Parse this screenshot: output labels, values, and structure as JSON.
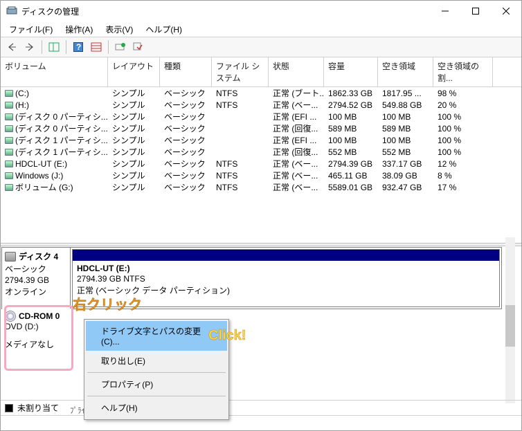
{
  "window": {
    "title": "ディスクの管理"
  },
  "menubar": [
    "ファイル(F)",
    "操作(A)",
    "表示(V)",
    "ヘルプ(H)"
  ],
  "columns": [
    "ボリューム",
    "レイアウト",
    "種類",
    "ファイル システム",
    "状態",
    "容量",
    "空き領域",
    "空き領域の割..."
  ],
  "rows": [
    {
      "vol": "(C:)",
      "layout": "シンプル",
      "type": "ベーシック",
      "fs": "NTFS",
      "status": "正常 (ブート...",
      "cap": "1862.33 GB",
      "free": "1817.95 ...",
      "pct": "98 %"
    },
    {
      "vol": "(H:)",
      "layout": "シンプル",
      "type": "ベーシック",
      "fs": "NTFS",
      "status": "正常 (ベー...",
      "cap": "2794.52 GB",
      "free": "549.88 GB",
      "pct": "20 %"
    },
    {
      "vol": "(ディスク 0 パーティシ...",
      "layout": "シンプル",
      "type": "ベーシック",
      "fs": "",
      "status": "正常 (EFI ...",
      "cap": "100 MB",
      "free": "100 MB",
      "pct": "100 %"
    },
    {
      "vol": "(ディスク 0 パーティシ...",
      "layout": "シンプル",
      "type": "ベーシック",
      "fs": "",
      "status": "正常 (回復...",
      "cap": "589 MB",
      "free": "589 MB",
      "pct": "100 %"
    },
    {
      "vol": "(ディスク 1 パーティシ...",
      "layout": "シンプル",
      "type": "ベーシック",
      "fs": "",
      "status": "正常 (EFI ...",
      "cap": "100 MB",
      "free": "100 MB",
      "pct": "100 %"
    },
    {
      "vol": "(ディスク 1 パーティシ...",
      "layout": "シンプル",
      "type": "ベーシック",
      "fs": "",
      "status": "正常 (回復...",
      "cap": "552 MB",
      "free": "552 MB",
      "pct": "100 %"
    },
    {
      "vol": "HDCL-UT (E:)",
      "layout": "シンプル",
      "type": "ベーシック",
      "fs": "NTFS",
      "status": "正常 (ベー...",
      "cap": "2794.39 GB",
      "free": "337.17 GB",
      "pct": "12 %"
    },
    {
      "vol": "Windows (J:)",
      "layout": "シンプル",
      "type": "ベーシック",
      "fs": "NTFS",
      "status": "正常 (ベー...",
      "cap": "465.11 GB",
      "free": "38.09 GB",
      "pct": "8 %"
    },
    {
      "vol": "ボリューム (G:)",
      "layout": "シンプル",
      "type": "ベーシック",
      "fs": "NTFS",
      "status": "正常 (ベー...",
      "cap": "5589.01 GB",
      "free": "932.47 GB",
      "pct": "17 %"
    }
  ],
  "disk4": {
    "title": "ディスク 4",
    "type": "ベーシック",
    "size": "2794.39 GB",
    "state": "オンライン",
    "part_title": "HDCL-UT  (E:)",
    "part_size": "2794.39 GB NTFS",
    "part_status": "正常 (ベーシック データ パーティション)"
  },
  "cdrom": {
    "title": "CD-ROM 0",
    "drive": "DVD (D:)",
    "state": "メディアなし"
  },
  "context": {
    "change": "ドライブ文字とパスの変更(C)...",
    "eject": "取り出し(E)",
    "prop": "プロパティ(P)",
    "help": "ヘルプ(H)"
  },
  "annotations": {
    "rightclick": "右クリック",
    "click": "Click!"
  },
  "legend": {
    "unalloc": "未割り当て",
    "partial": "ﾌﾟﾗｲﾏﾘ ﾊﾟｰﾃｨｼｮﾝ"
  }
}
